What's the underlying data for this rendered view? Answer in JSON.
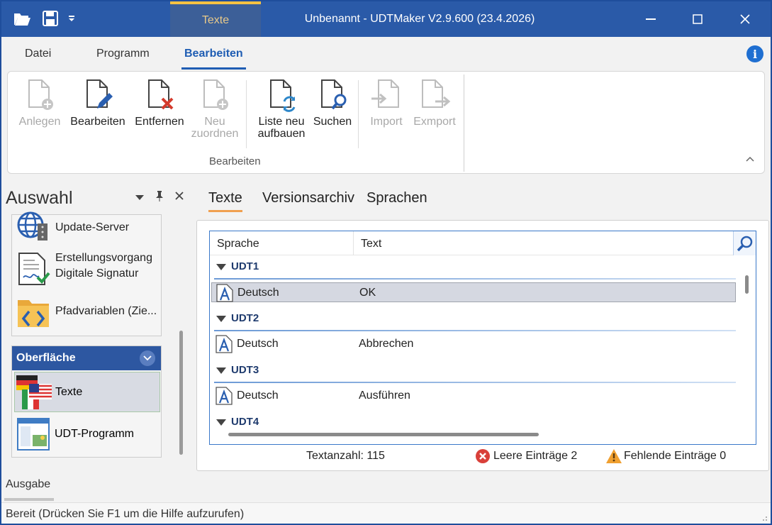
{
  "window": {
    "title": "Unbenannt - UDTMaker V2.9.600 (23.4.2026)",
    "context_tab": "Texte"
  },
  "ribbon_tabs": [
    {
      "label": "Datei"
    },
    {
      "label": "Programm"
    },
    {
      "label": "Bearbeiten",
      "active": true
    }
  ],
  "ribbon": {
    "buttons": [
      {
        "label": "Anlegen",
        "enabled": false,
        "icon": "add-document-icon"
      },
      {
        "label": "Bearbeiten",
        "enabled": true,
        "icon": "edit-document-icon"
      },
      {
        "label": "Entfernen",
        "enabled": true,
        "icon": "delete-document-icon"
      },
      {
        "label1": "Neu",
        "label2": "zuordnen",
        "enabled": false,
        "icon": "assign-document-icon"
      },
      {
        "label1": "Liste neu",
        "label2": "aufbauen",
        "enabled": true,
        "icon": "refresh-document-icon"
      },
      {
        "label": "Suchen",
        "enabled": true,
        "icon": "search-document-icon"
      },
      {
        "label": "Import",
        "enabled": false,
        "icon": "import-icon"
      },
      {
        "label": "Exmport",
        "enabled": false,
        "icon": "export-icon"
      }
    ],
    "group_label": "Bearbeiten"
  },
  "left_panel": {
    "title": "Auswahl",
    "tree_items": [
      {
        "label": "Update-Server",
        "icon": "globe-server-icon"
      },
      {
        "label1": "Erstellungsvorgang",
        "label2": "Digitale Signatur",
        "icon": "signature-icon"
      },
      {
        "label": "Pfadvariablen (Zie...",
        "icon": "folder-code-icon"
      }
    ],
    "section_header": "Oberfläche",
    "section_items": [
      {
        "label": "Texte",
        "icon": "flags-icon",
        "selected": true
      },
      {
        "label": "UDT-Programm",
        "icon": "program-window-icon"
      }
    ]
  },
  "content_tabs": [
    {
      "label": "Texte",
      "active": true
    },
    {
      "label": "Versionsarchiv"
    },
    {
      "label": "Sprachen"
    }
  ],
  "grid": {
    "columns": [
      "Sprache",
      "Text"
    ],
    "groups": [
      {
        "name": "UDT1",
        "rows": [
          {
            "language": "Deutsch",
            "text": "OK",
            "selected": true
          }
        ]
      },
      {
        "name": "UDT2",
        "rows": [
          {
            "language": "Deutsch",
            "text": "Abbrechen"
          }
        ]
      },
      {
        "name": "UDT3",
        "rows": [
          {
            "language": "Deutsch",
            "text": "Ausführen"
          }
        ]
      },
      {
        "name": "UDT4",
        "rows": []
      }
    ]
  },
  "status_row": {
    "count": "Textanzahl: 115",
    "empty": "Leere Einträge 2",
    "missing": "Fehlende Einträge 0"
  },
  "output_label": "Ausgabe",
  "statusbar_text": "Bereit (Drücken Sie F1 um die Hilfe aufzurufen)",
  "colors": {
    "titlebar": "#2a5aa8",
    "accent": "#1f5db3",
    "section_header": "#2d57a1",
    "error": "#d9403a",
    "warning": "#f0a030"
  }
}
